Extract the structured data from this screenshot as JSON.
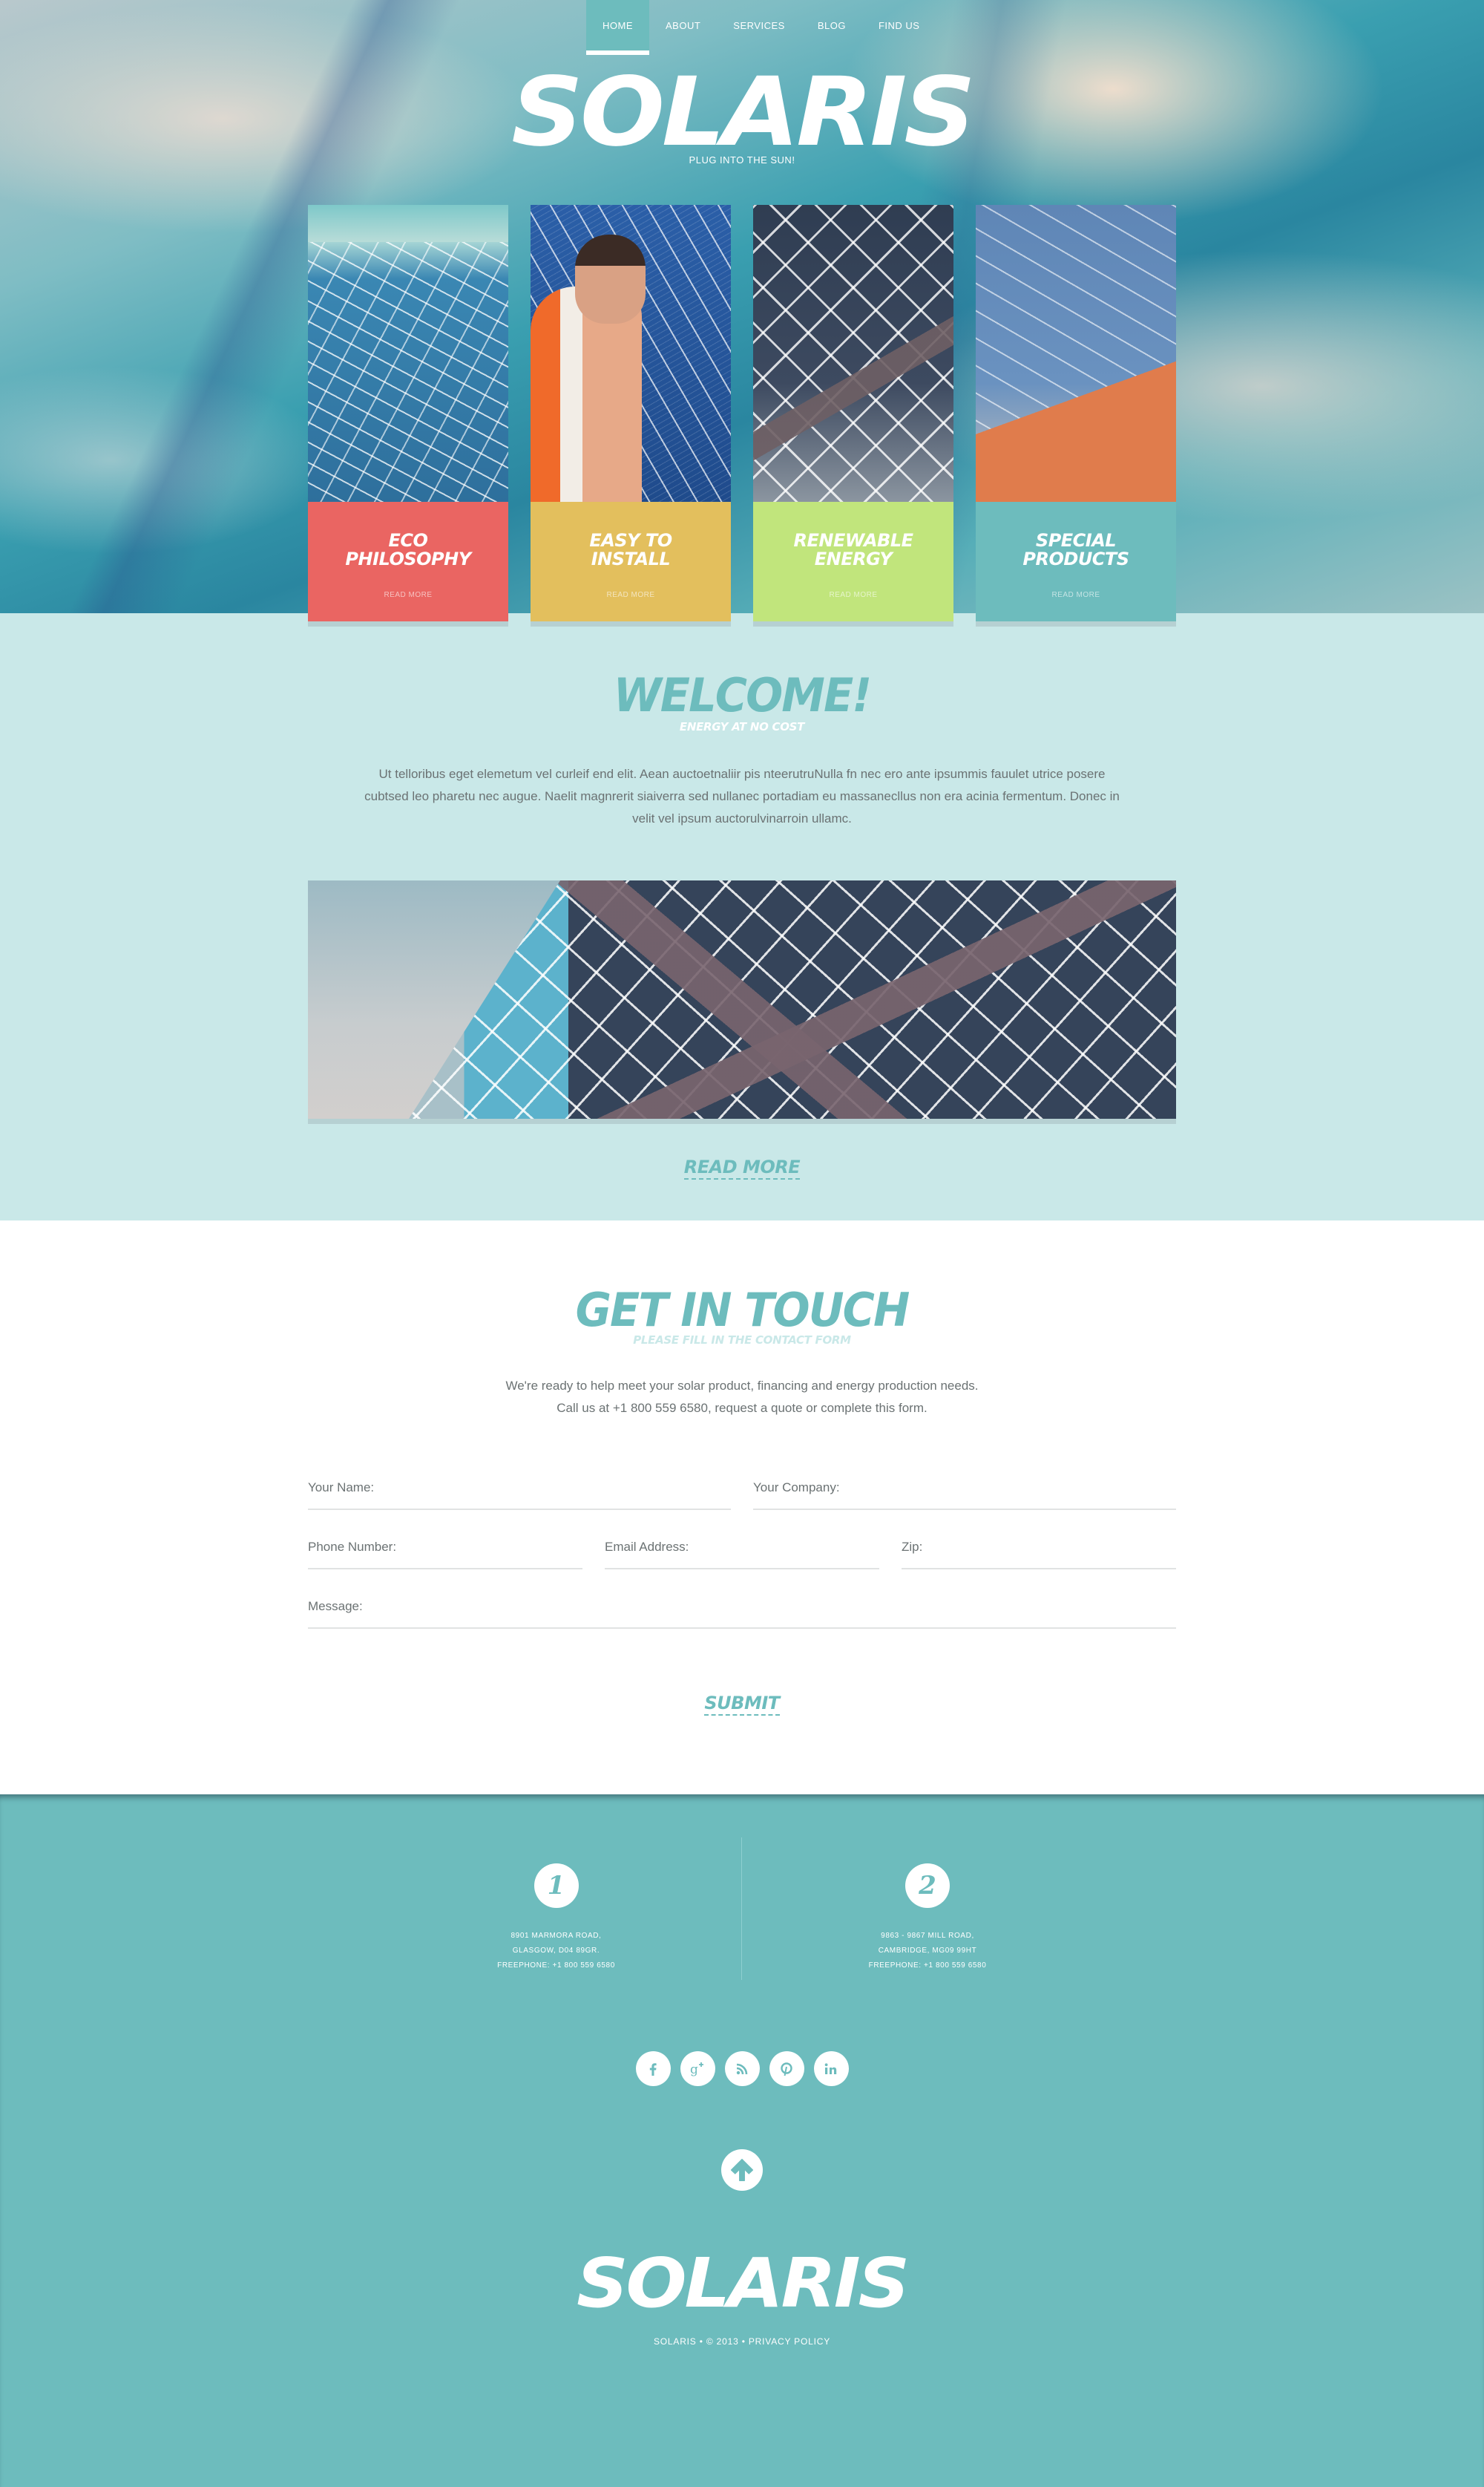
{
  "nav": {
    "items": [
      {
        "label": "Home",
        "active": true
      },
      {
        "label": "About",
        "active": false
      },
      {
        "label": "Services",
        "active": false
      },
      {
        "label": "Blog",
        "active": false
      },
      {
        "label": "Find Us",
        "active": false
      }
    ]
  },
  "hero": {
    "logo": "SOLARIS",
    "tagline": "PLUG INTO THE SUN!"
  },
  "cards": [
    {
      "title": "ECO\nPHILOSOPHY",
      "link": "Read More",
      "color": "#ea6562"
    },
    {
      "title": "EASY TO\nINSTALL",
      "link": "Read More",
      "color": "#e3bf5d"
    },
    {
      "title": "RENEWABLE\nENERGY",
      "link": "Read More",
      "color": "#c1e57c"
    },
    {
      "title": "SPECIAL\nPRODUCTS",
      "link": "Read More",
      "color": "#6dbcbd"
    }
  ],
  "welcome": {
    "title": "WELCOME!",
    "subtitle": "ENERGY AT NO COST",
    "text": "Ut telloribus eget elemetum vel curleif end elit. Aean auctoetnaliir pis nteerutruNulla fn nec ero ante ipsummis fauulet utrice posere cubtsed leo pharetu nec augue. Naelit magnrerit siaiverra sed nullanec portadiam eu massanecllus non era acinia fermentum. Donec in velit vel ipsum auctorulvinarroin ullamc.",
    "read_more": "READ MORE"
  },
  "contact": {
    "title": "GET IN TOUCH",
    "subtitle": "PLEASE FILL IN THE CONTACT FORM",
    "text_line1": "We're ready to help meet your solar product, financing and energy production needs.",
    "text_line2": "Call us at +1 800 559 6580, request a quote or complete this form.",
    "fields": {
      "name": {
        "placeholder": "Your Name:",
        "value": ""
      },
      "company": {
        "placeholder": "Your Company:",
        "value": ""
      },
      "phone": {
        "placeholder": "Phone Number:",
        "value": ""
      },
      "email": {
        "placeholder": "Email Address:",
        "value": ""
      },
      "zip": {
        "placeholder": "Zip:",
        "value": ""
      },
      "message": {
        "placeholder": "Message:",
        "value": ""
      }
    },
    "submit": "SUBMIT"
  },
  "footer": {
    "offices": [
      {
        "number": "1",
        "line1": "8901 Marmora Road,",
        "line2": "Glasgow, D04 89GR.",
        "line3": "Freephone:  +1 800 559 6580"
      },
      {
        "number": "2",
        "line1": "9863 - 9867 Mill Road,",
        "line2": "Cambridge, MG09 99HT",
        "line3": "Freephone:  +1 800 559 6580"
      }
    ],
    "social": [
      {
        "name": "facebook",
        "icon": "facebook-icon"
      },
      {
        "name": "google-plus",
        "icon": "google-plus-icon"
      },
      {
        "name": "rss",
        "icon": "rss-icon"
      },
      {
        "name": "pinterest",
        "icon": "pinterest-icon"
      },
      {
        "name": "linkedin",
        "icon": "linkedin-icon"
      }
    ],
    "back_to_top_icon": "arrow-up-icon",
    "logo": "SOLARIS",
    "copyright_brand": "SOLARIS",
    "copyright_sep": "•",
    "copyright_year": "© 2013",
    "privacy": "PRIVACY POLICY"
  },
  "colors": {
    "accent": "#6dbcbd",
    "welcome_bg": "#c9e8e8",
    "eco": "#ea6562",
    "install": "#e3bf5d",
    "renewable": "#c1e57c",
    "special": "#6dbcbd"
  }
}
